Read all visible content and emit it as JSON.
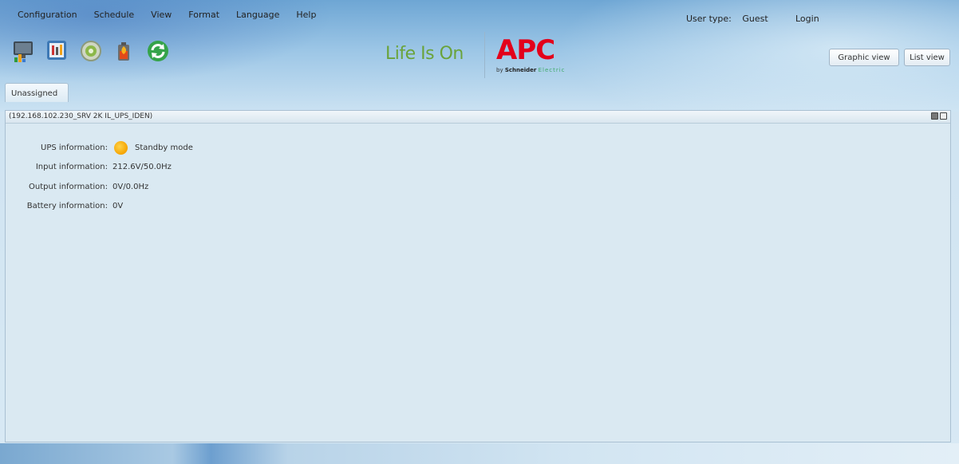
{
  "menu": [
    "Configuration",
    "Schedule",
    "View",
    "Format",
    "Language",
    "Help"
  ],
  "user": {
    "label": "User type:",
    "value": "Guest",
    "login": "Login"
  },
  "brand": {
    "tagline": "Life Is On",
    "logo_text": "APC",
    "sub_by": "by",
    "sub_company": "Schneider",
    "sub_electric": "Electric",
    "tagline_color": "#6aa33a",
    "logo_color": "#e3001b"
  },
  "views": {
    "graphic": "Graphic view",
    "list": "List view"
  },
  "tab": {
    "label": "Unassigned"
  },
  "panel": {
    "title": "(192.168.102.230_SRV 2K IL_UPS_IDEN)",
    "rows": [
      {
        "label": "UPS information:",
        "value": "Standby mode",
        "status_color": "#f5a300"
      },
      {
        "label": "Input information:",
        "value": "212.6V/50.0Hz"
      },
      {
        "label": "Output information:",
        "value": "0V/0.0Hz"
      },
      {
        "label": "Battery information:",
        "value": "0V"
      }
    ]
  },
  "toolbar_icons": [
    "monitor-chart-icon",
    "settings-tools-icon",
    "power-button-icon",
    "battery-fire-icon",
    "refresh-icon"
  ]
}
